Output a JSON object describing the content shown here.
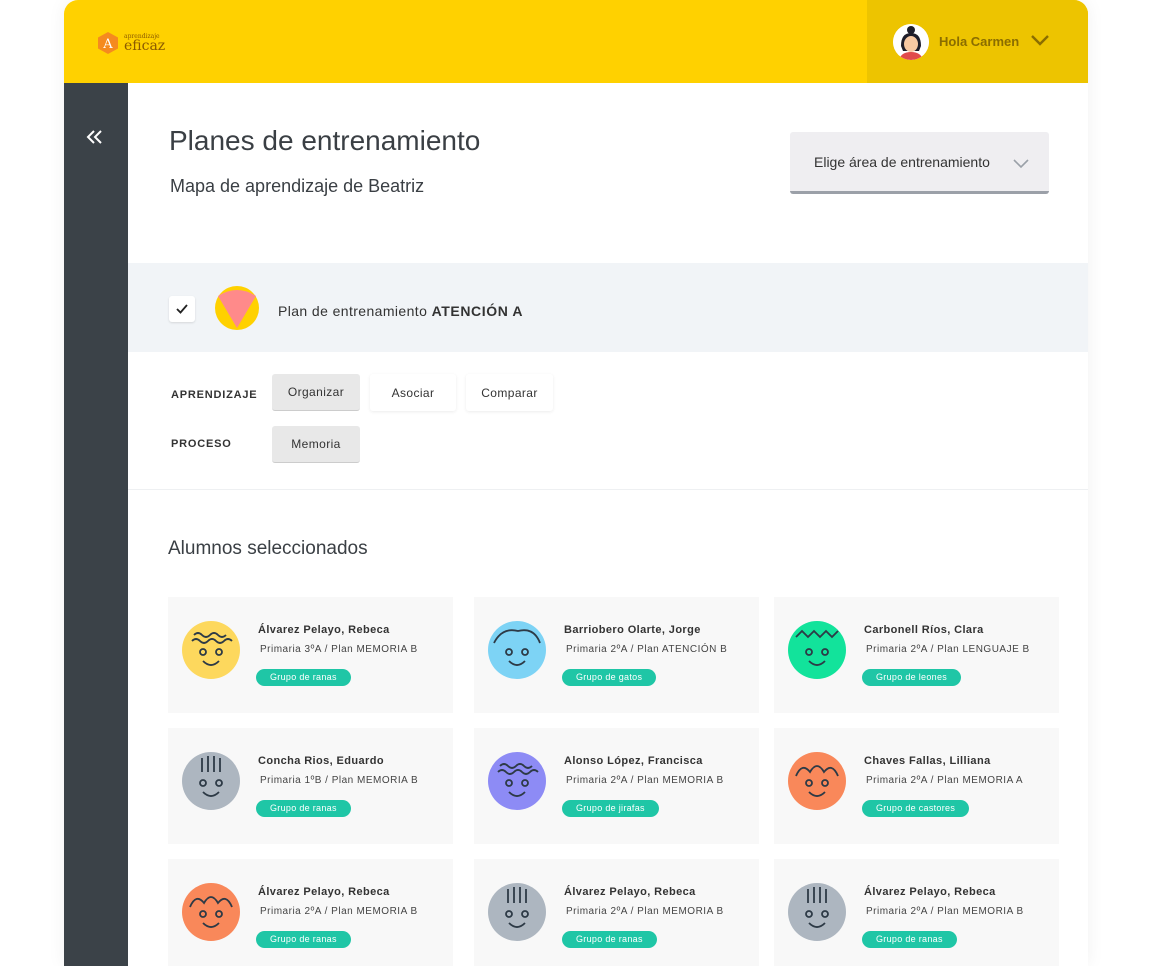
{
  "brand": {
    "small": "aprendizaje",
    "big": "eficaz",
    "mark": "A"
  },
  "user": {
    "greeting": "Hola Carmen"
  },
  "page": {
    "title": "Planes de entrenamiento",
    "subtitle": "Mapa de aprendizaje de Beatriz",
    "area_select": "Elige área de entrenamiento"
  },
  "plan": {
    "prefix": "Plan de entrenamiento",
    "name": "ATENCIÓN A",
    "checked": true
  },
  "filters": {
    "learning_label": "APRENDIZAJE",
    "learning_options": [
      "Organizar",
      "Asociar",
      "Comparar"
    ],
    "learning_active": "Organizar",
    "process_label": "PROCESO",
    "process_options": [
      "Memoria"
    ],
    "process_active": "Memoria"
  },
  "students_title": "Alumnos seleccionados",
  "students": [
    {
      "name": "Álvarez Pelayo, Rebeca",
      "meta": "Primaria 3ºA   / Plan MEMORIA B",
      "group": "Grupo de ranas",
      "color": "#FDD85D",
      "face": "wave"
    },
    {
      "name": "Barriobero Olarte, Jorge",
      "meta": "Primaria 2ºA   / Plan ATENCIÓN B",
      "group": "Grupo de gatos",
      "color": "#7DD3F5",
      "face": "cool"
    },
    {
      "name": "Carbonell Ríos, Clara",
      "meta": "Primaria 2ºA   / Plan LENGUAJE B",
      "group": "Grupo de leones",
      "color": "#12E39B",
      "face": "spiky"
    },
    {
      "name": "Concha Rios, Eduardo",
      "meta": "Primaria 1ºB   / Plan MEMORIA B",
      "group": "Grupo de ranas",
      "color": "#ADB6C0",
      "face": "lines"
    },
    {
      "name": "Alonso López, Francisca",
      "meta": "Primaria 2ºA   / Plan MEMORIA B",
      "group": "Grupo de jirafas",
      "color": "#8D8BF5",
      "face": "wave"
    },
    {
      "name": "Chaves Fallas, Lilliana",
      "meta": "Primaria 2ºA   / Plan MEMORIA A",
      "group": "Grupo de castores",
      "color": "#F9885A",
      "face": "curl"
    },
    {
      "name": "Álvarez Pelayo, Rebeca",
      "meta": "Primaria 2ºA   / Plan MEMORIA B",
      "group": "Grupo de ranas",
      "color": "#F9885A",
      "face": "curl"
    },
    {
      "name": "Álvarez Pelayo, Rebeca",
      "meta": "Primaria 2ºA   / Plan MEMORIA B",
      "group": "Grupo de ranas",
      "color": "#ADB6C0",
      "face": "lines"
    },
    {
      "name": "Álvarez Pelayo, Rebeca",
      "meta": "Primaria 2ºA   / Plan MEMORIA B",
      "group": "Grupo de ranas",
      "color": "#ADB6C0",
      "face": "lines"
    }
  ],
  "colors": {
    "topbar": "#FFD100",
    "user_box": "#EDC400",
    "sidebar": "#3B4248",
    "badge": "#1FC6A6",
    "plan_pink": "#FF8A8A",
    "plan_yellow": "#FFD100"
  },
  "icons": {
    "collapse": "double-chevron-left-icon",
    "dropdown": "chevron-down-icon",
    "check": "check-icon"
  }
}
